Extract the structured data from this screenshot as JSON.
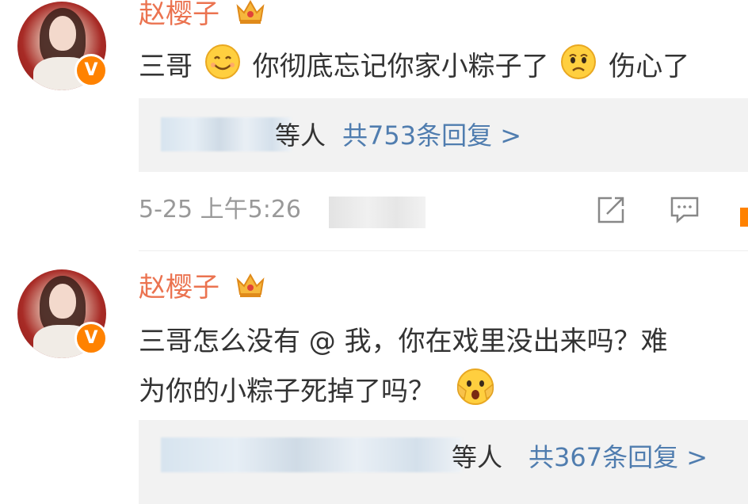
{
  "comments": [
    {
      "username": "赵樱子",
      "text_parts": [
        "三哥",
        "你彻底忘记你家小粽子了",
        "伤心了"
      ],
      "replies": {
        "name_tail": "等人",
        "count_label": "共753条回复 >"
      },
      "time": "5-25 上午5:26"
    },
    {
      "username": "赵樱子",
      "text_line1": "三哥怎么没有 @ 我，你在戏里没出来吗？难",
      "text_line2": "为你的小粽子死掉了吗？",
      "replies": {
        "name_tail": "等人",
        "count_label": "共367条回复 >"
      }
    }
  ],
  "icons": {
    "verified": "v-badge-icon",
    "crown": "crown-icon",
    "smile": "smile-emoji",
    "sad": "sad-emoji",
    "shocked": "shocked-emoji",
    "share": "share-icon",
    "comment": "comment-icon"
  },
  "colors": {
    "username": "#eb7350",
    "reply_link": "#507daf",
    "meta": "#999999",
    "badge": "#ff8200"
  }
}
